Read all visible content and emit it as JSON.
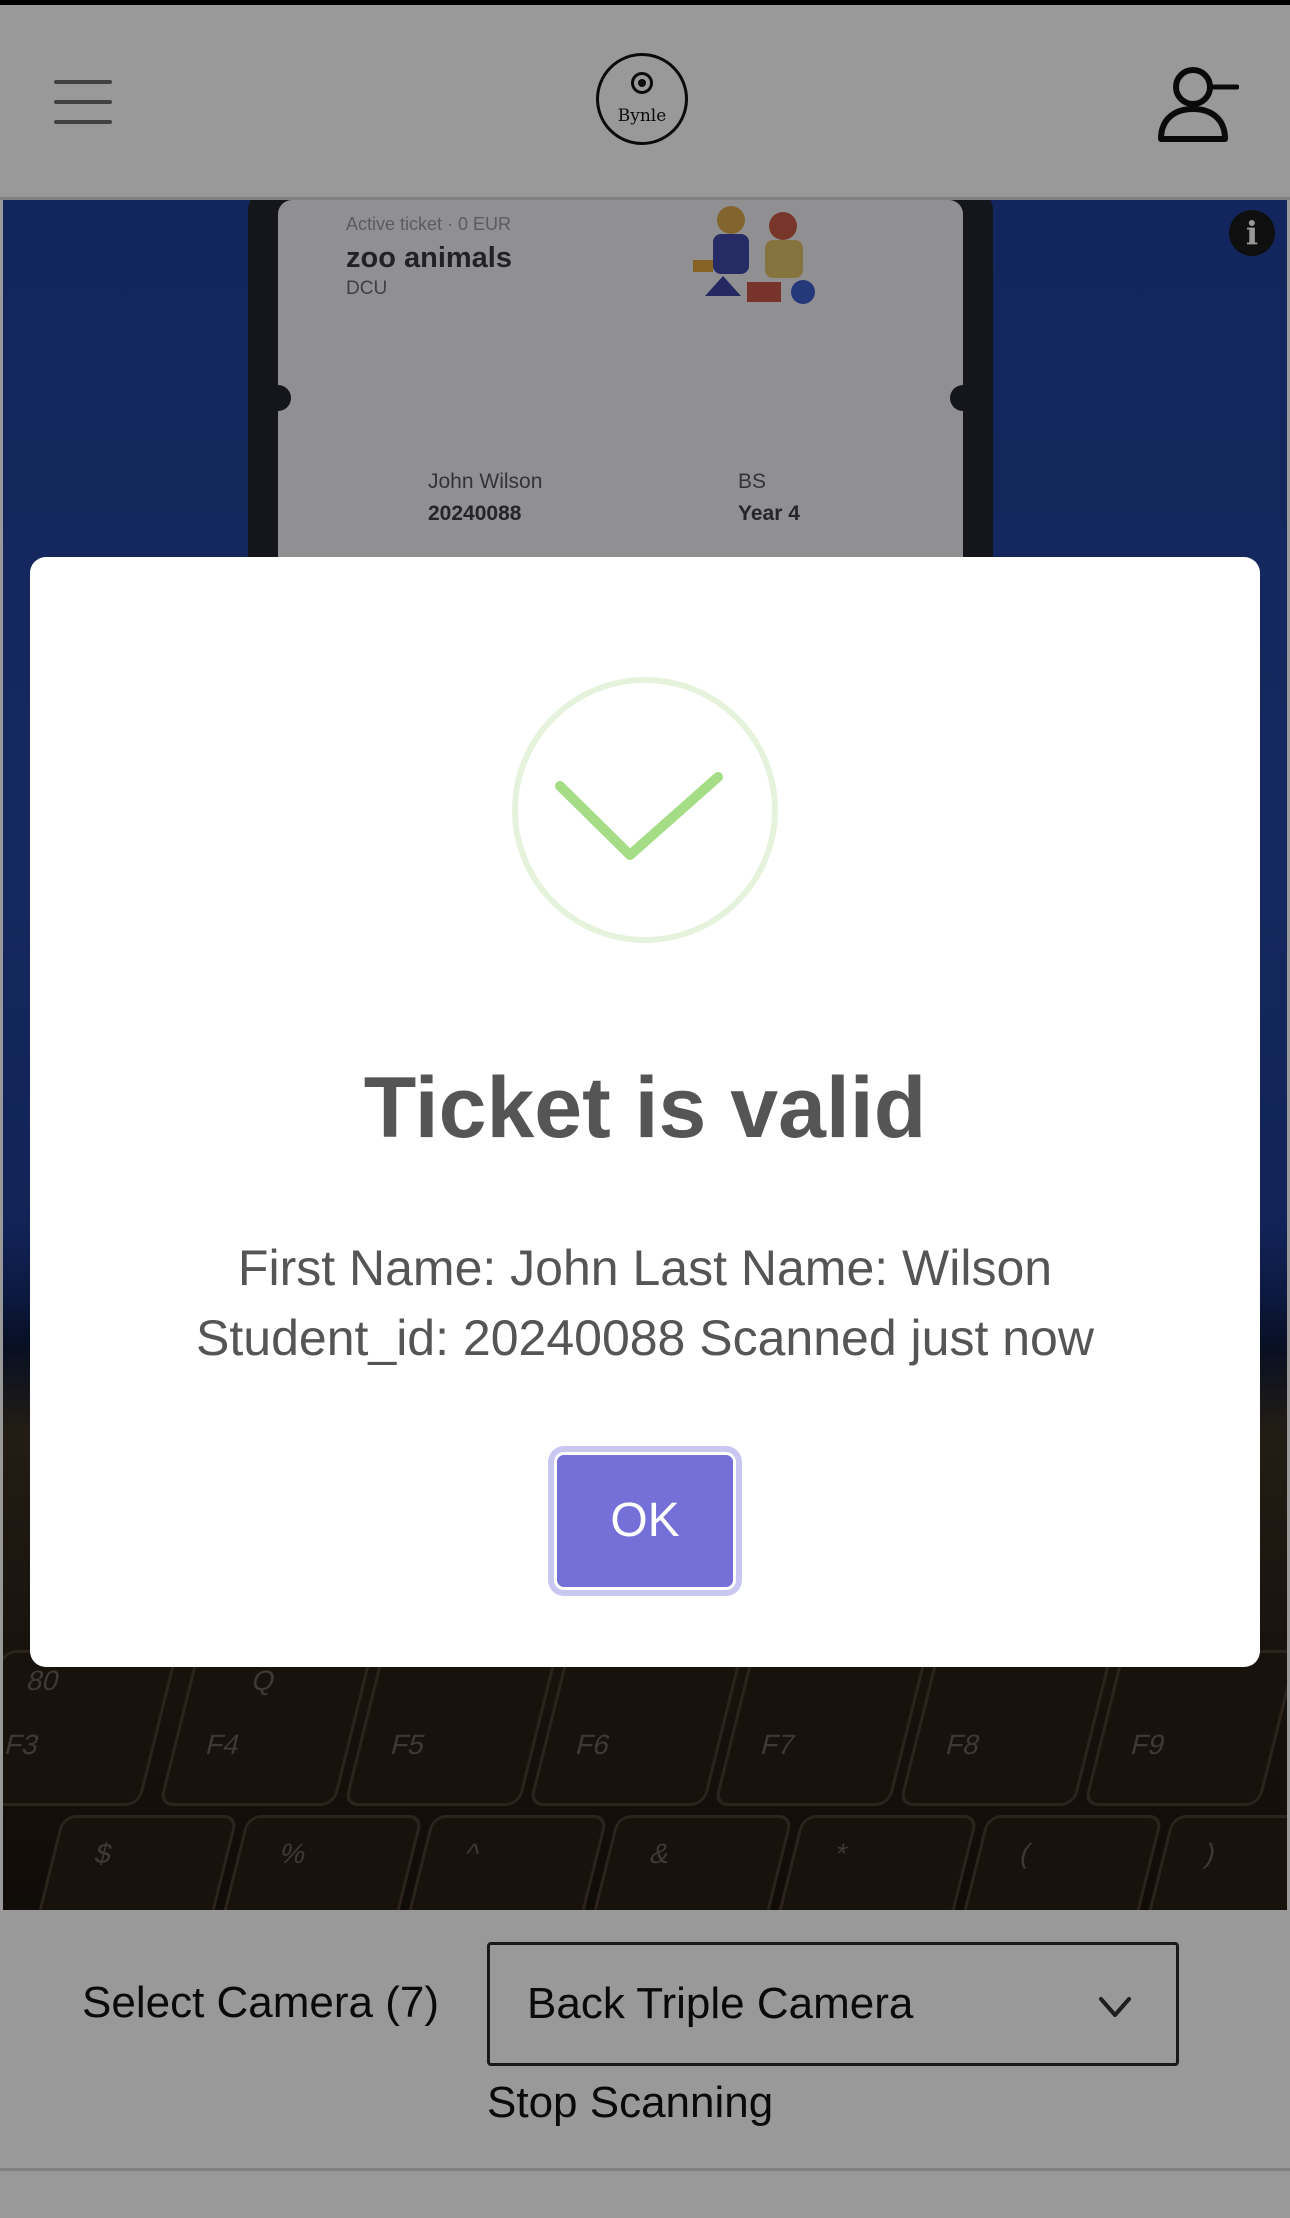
{
  "header": {
    "menu_icon": "hamburger-menu-icon",
    "logo_text": "Bynle",
    "user_icon": "user-remove-icon"
  },
  "camera_view": {
    "ticket": {
      "status": "Active ticket · 0 EUR",
      "event_name": "zoo animals",
      "organization": "DCU",
      "person_name": "John Wilson",
      "student_id": "20240088",
      "course": "BS",
      "year": "Year 4"
    },
    "keyboard_labels": [
      "80",
      "F3",
      "F4",
      "F5",
      "F6",
      "F7",
      "F8",
      "F9",
      "$",
      "%",
      "^",
      "&",
      "*",
      "(",
      ")"
    ]
  },
  "controls": {
    "select_camera_label": "Select Camera (7)",
    "camera_select_value": "Back Triple Camera",
    "stop_scanning_label": "Stop Scanning"
  },
  "modal": {
    "icon": "checkmark-success-icon",
    "title": "Ticket is valid",
    "message": "First Name: John Last Name: Wilson Student_id: 20240088 Scanned just now",
    "ok_label": "OK"
  },
  "colors": {
    "accent": "#7470d8",
    "success_check": "#a5dc86",
    "success_ring": "#e6f3dc",
    "title_text": "#555555"
  }
}
